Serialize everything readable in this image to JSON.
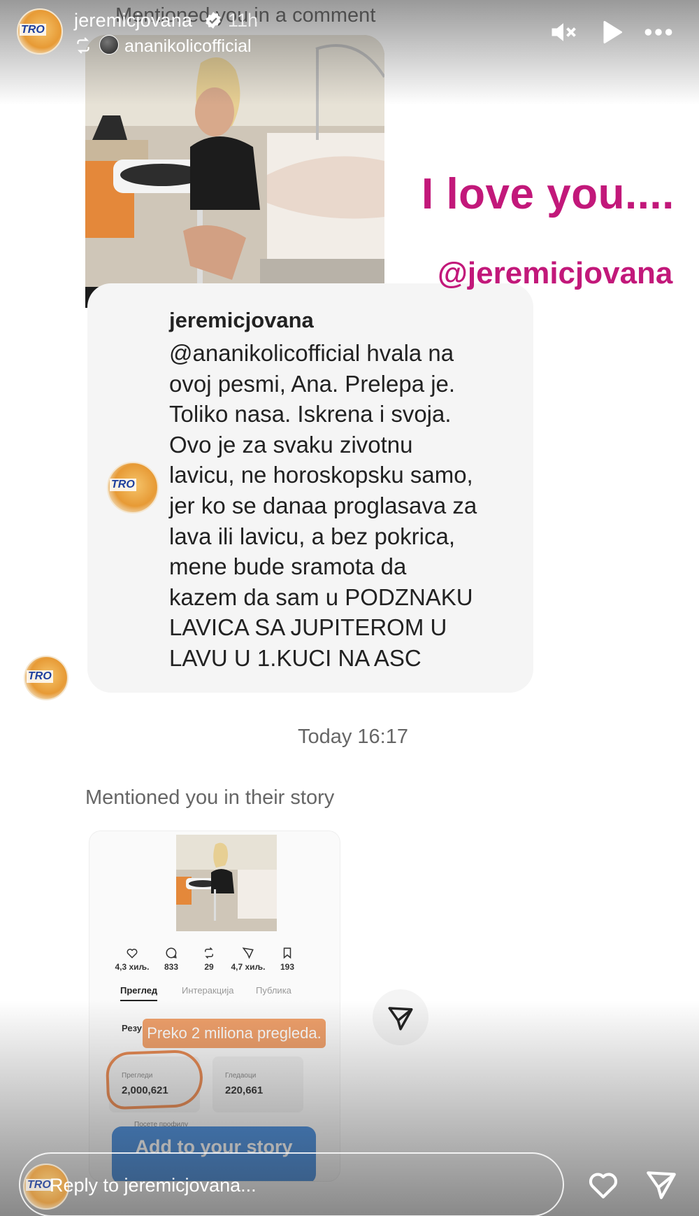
{
  "header": {
    "username": "jeremicjovana",
    "time_ago": "11h",
    "reposted_from": "ananikolicofficial",
    "faded_text": "Mentioned you in a comment"
  },
  "stickers": {
    "love_text": "I love you....",
    "mention": "@jeremicjovana"
  },
  "comment": {
    "username": "jeremicjovana",
    "text": "@ananikolicofficial hvala na\novoj pesmi, Ana. Prelepa je.\nToliko nasa. Iskrena i svoja.\nOvo je za svaku zivotnu\nlavicu, ne horoskopsku samo,\njer ko se danaa proglasava za\nlava ili lavicu, a bez pokrica,\nmene bude sramota da\nkazem da sam u PODZNAKU\nLAVICA SA JUPITEROM U\nLAVU U 1.KUCI NA ASC"
  },
  "chat": {
    "timestamp": "Today 16:17",
    "mentioned_label": "Mentioned you in their story"
  },
  "story_preview": {
    "stats": [
      {
        "icon": "heart-icon",
        "value": "4,3 хиљ."
      },
      {
        "icon": "comment-icon",
        "value": "833"
      },
      {
        "icon": "repost-icon",
        "value": "29"
      },
      {
        "icon": "send-icon",
        "value": "4,7 хиљ."
      },
      {
        "icon": "bookmark-icon",
        "value": "193"
      }
    ],
    "tabs": [
      "Преглед",
      "Интеракција",
      "Публика"
    ],
    "section_label": "Резу",
    "banner": "Preko 2 miliona pregleda.",
    "metric_1_label": "Прегледи",
    "metric_1_value": "2,000,621",
    "metric_2_label": "Гледаоци",
    "metric_2_value": "220,661",
    "footer_label": "Посете профилу",
    "add_story": "Add to your story"
  },
  "footer": {
    "reply_placeholder": "Reply to jeremicjovana..."
  },
  "colors": {
    "accent_pink": "#c2187a",
    "banner_orange": "#f0a06a",
    "add_story_blue": "#4a8fde"
  }
}
